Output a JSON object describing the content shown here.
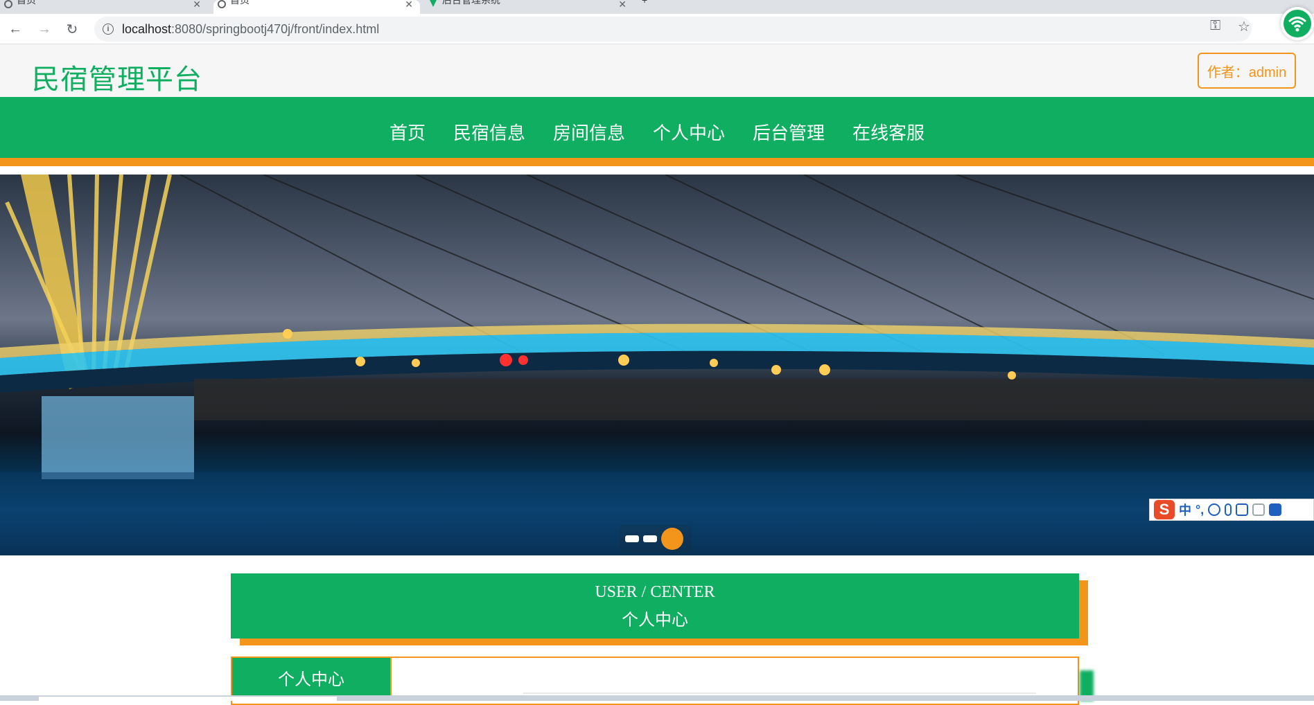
{
  "browser": {
    "tabs": [
      {
        "title": "首页"
      },
      {
        "title": "首页"
      },
      {
        "title": "后台管理系统"
      }
    ],
    "new_tab": "+",
    "url_host": "localhost",
    "url_rest": ":8080/springbootj470j/front/index.html"
  },
  "site": {
    "title": "民宿管理平台",
    "author": "作者：admin"
  },
  "nav": {
    "items": [
      "首页",
      "民宿信息",
      "房间信息",
      "个人中心",
      "后台管理",
      "在线客服"
    ]
  },
  "banner": {
    "slide_count": 3,
    "active_slide": 3
  },
  "section": {
    "title_en": "USER / CENTER",
    "title_zh": "个人中心",
    "side_tab": "个人中心"
  },
  "ime": {
    "labels": [
      "中",
      "°,"
    ]
  },
  "colors": {
    "brand_green": "#0fae60",
    "accent_orange": "#f3941b"
  }
}
